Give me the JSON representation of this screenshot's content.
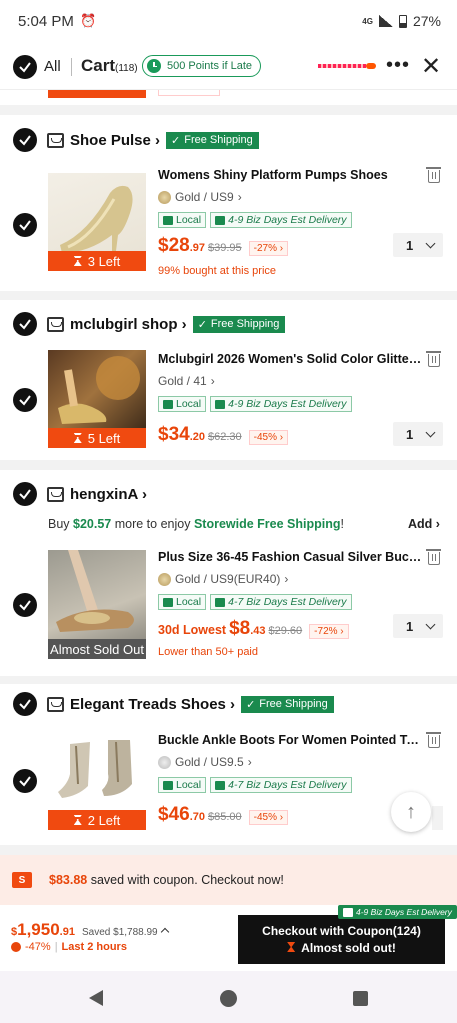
{
  "status_bar": {
    "time": "5:04 PM",
    "network": "4G LTE",
    "battery": "27%"
  },
  "header": {
    "all_label": "All",
    "cart_label": "Cart",
    "cart_count": "(118)",
    "points_label": "500 Points if Late"
  },
  "stores": [
    {
      "name": "Shoe Pulse",
      "badge": "Free Shipping",
      "product": {
        "title": "Womens Shiny Platform Pumps Shoes",
        "variant": "Gold / US9",
        "chip_local": "Local",
        "chip_delivery": "4-9 Biz Days Est Delivery",
        "price_int": "$28",
        "price_dec": ".97",
        "orig": "$39.95",
        "discount": "-27%",
        "note": "99% bought at this price",
        "timer": "3 Left",
        "qty": "1"
      }
    },
    {
      "name": "mclubgirl shop",
      "badge": "Free Shipping",
      "product": {
        "title": "Mclubgirl 2026 Women's Solid Color Glitter Sa...",
        "variant": "Gold / 41",
        "chip_local": "Local",
        "chip_delivery": "4-9 Biz Days Est Delivery",
        "price_int": "$34",
        "price_dec": ".20",
        "orig": "$62.30",
        "discount": "-45%",
        "timer": "5 Left",
        "qty": "1"
      }
    },
    {
      "name": "hengxinA",
      "buy_more": {
        "prefix": "Buy ",
        "amount": "$20.57",
        "middle": " more to enjoy ",
        "highlight": "Storewide Free Shipping",
        "suffix": "!",
        "add": "Add"
      },
      "product": {
        "title": "Plus Size 36-45 Fashion Casual Silver Buckle ...",
        "variant": "Gold / US9(EUR40)",
        "chip_local": "Local",
        "chip_delivery": "4-7 Biz Days Est Delivery",
        "price_prefix": "30d Lowest ",
        "price_int": "$8",
        "price_dec": ".43",
        "orig": "$29.60",
        "discount": "-72%",
        "note": "Lower than 50+ paid",
        "timer": "Almost Sold Out",
        "qty": "1"
      }
    },
    {
      "name": "Elegant Treads Shoes",
      "badge": "Free Shipping",
      "product": {
        "title": "Buckle Ankle Boots For Women Pointed Toe H...",
        "variant": "Gold / US9.5",
        "chip_local": "Local",
        "chip_delivery": "4-7 Biz Days Est Delivery",
        "price_int": "$46",
        "price_dec": ".70",
        "orig": "$85.00",
        "discount": "-45%",
        "timer": "2 Left"
      }
    }
  ],
  "coupon": {
    "icon": "S",
    "amount": "$83.88",
    "text": " saved with coupon. Checkout now!"
  },
  "footer": {
    "total_int": "$1,950",
    "total_dec": ".91",
    "saved": "Saved $1,788.99",
    "discount": "-47%",
    "last": "Last 2 hours",
    "checkout_label": "Checkout with Coupon(124)",
    "checkout_sub": "Almost sold out!",
    "est_badge": "4-9 Biz Days Est Delivery"
  },
  "colors": {
    "accent": "#e8450a",
    "green": "#1a8a4e",
    "dark": "#111111"
  }
}
